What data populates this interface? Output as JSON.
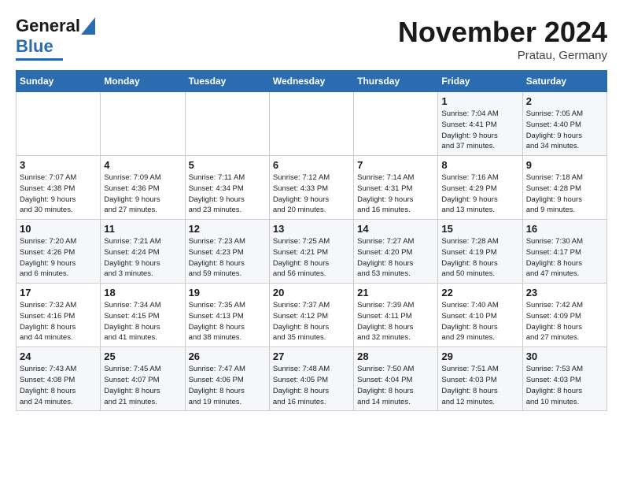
{
  "header": {
    "logo_general": "General",
    "logo_blue": "Blue",
    "month": "November 2024",
    "location": "Pratau, Germany"
  },
  "days_of_week": [
    "Sunday",
    "Monday",
    "Tuesday",
    "Wednesday",
    "Thursday",
    "Friday",
    "Saturday"
  ],
  "weeks": [
    [
      {
        "day": "",
        "info": ""
      },
      {
        "day": "",
        "info": ""
      },
      {
        "day": "",
        "info": ""
      },
      {
        "day": "",
        "info": ""
      },
      {
        "day": "",
        "info": ""
      },
      {
        "day": "1",
        "info": "Sunrise: 7:04 AM\nSunset: 4:41 PM\nDaylight: 9 hours\nand 37 minutes."
      },
      {
        "day": "2",
        "info": "Sunrise: 7:05 AM\nSunset: 4:40 PM\nDaylight: 9 hours\nand 34 minutes."
      }
    ],
    [
      {
        "day": "3",
        "info": "Sunrise: 7:07 AM\nSunset: 4:38 PM\nDaylight: 9 hours\nand 30 minutes."
      },
      {
        "day": "4",
        "info": "Sunrise: 7:09 AM\nSunset: 4:36 PM\nDaylight: 9 hours\nand 27 minutes."
      },
      {
        "day": "5",
        "info": "Sunrise: 7:11 AM\nSunset: 4:34 PM\nDaylight: 9 hours\nand 23 minutes."
      },
      {
        "day": "6",
        "info": "Sunrise: 7:12 AM\nSunset: 4:33 PM\nDaylight: 9 hours\nand 20 minutes."
      },
      {
        "day": "7",
        "info": "Sunrise: 7:14 AM\nSunset: 4:31 PM\nDaylight: 9 hours\nand 16 minutes."
      },
      {
        "day": "8",
        "info": "Sunrise: 7:16 AM\nSunset: 4:29 PM\nDaylight: 9 hours\nand 13 minutes."
      },
      {
        "day": "9",
        "info": "Sunrise: 7:18 AM\nSunset: 4:28 PM\nDaylight: 9 hours\nand 9 minutes."
      }
    ],
    [
      {
        "day": "10",
        "info": "Sunrise: 7:20 AM\nSunset: 4:26 PM\nDaylight: 9 hours\nand 6 minutes."
      },
      {
        "day": "11",
        "info": "Sunrise: 7:21 AM\nSunset: 4:24 PM\nDaylight: 9 hours\nand 3 minutes."
      },
      {
        "day": "12",
        "info": "Sunrise: 7:23 AM\nSunset: 4:23 PM\nDaylight: 8 hours\nand 59 minutes."
      },
      {
        "day": "13",
        "info": "Sunrise: 7:25 AM\nSunset: 4:21 PM\nDaylight: 8 hours\nand 56 minutes."
      },
      {
        "day": "14",
        "info": "Sunrise: 7:27 AM\nSunset: 4:20 PM\nDaylight: 8 hours\nand 53 minutes."
      },
      {
        "day": "15",
        "info": "Sunrise: 7:28 AM\nSunset: 4:19 PM\nDaylight: 8 hours\nand 50 minutes."
      },
      {
        "day": "16",
        "info": "Sunrise: 7:30 AM\nSunset: 4:17 PM\nDaylight: 8 hours\nand 47 minutes."
      }
    ],
    [
      {
        "day": "17",
        "info": "Sunrise: 7:32 AM\nSunset: 4:16 PM\nDaylight: 8 hours\nand 44 minutes."
      },
      {
        "day": "18",
        "info": "Sunrise: 7:34 AM\nSunset: 4:15 PM\nDaylight: 8 hours\nand 41 minutes."
      },
      {
        "day": "19",
        "info": "Sunrise: 7:35 AM\nSunset: 4:13 PM\nDaylight: 8 hours\nand 38 minutes."
      },
      {
        "day": "20",
        "info": "Sunrise: 7:37 AM\nSunset: 4:12 PM\nDaylight: 8 hours\nand 35 minutes."
      },
      {
        "day": "21",
        "info": "Sunrise: 7:39 AM\nSunset: 4:11 PM\nDaylight: 8 hours\nand 32 minutes."
      },
      {
        "day": "22",
        "info": "Sunrise: 7:40 AM\nSunset: 4:10 PM\nDaylight: 8 hours\nand 29 minutes."
      },
      {
        "day": "23",
        "info": "Sunrise: 7:42 AM\nSunset: 4:09 PM\nDaylight: 8 hours\nand 27 minutes."
      }
    ],
    [
      {
        "day": "24",
        "info": "Sunrise: 7:43 AM\nSunset: 4:08 PM\nDaylight: 8 hours\nand 24 minutes."
      },
      {
        "day": "25",
        "info": "Sunrise: 7:45 AM\nSunset: 4:07 PM\nDaylight: 8 hours\nand 21 minutes."
      },
      {
        "day": "26",
        "info": "Sunrise: 7:47 AM\nSunset: 4:06 PM\nDaylight: 8 hours\nand 19 minutes."
      },
      {
        "day": "27",
        "info": "Sunrise: 7:48 AM\nSunset: 4:05 PM\nDaylight: 8 hours\nand 16 minutes."
      },
      {
        "day": "28",
        "info": "Sunrise: 7:50 AM\nSunset: 4:04 PM\nDaylight: 8 hours\nand 14 minutes."
      },
      {
        "day": "29",
        "info": "Sunrise: 7:51 AM\nSunset: 4:03 PM\nDaylight: 8 hours\nand 12 minutes."
      },
      {
        "day": "30",
        "info": "Sunrise: 7:53 AM\nSunset: 4:03 PM\nDaylight: 8 hours\nand 10 minutes."
      }
    ]
  ]
}
